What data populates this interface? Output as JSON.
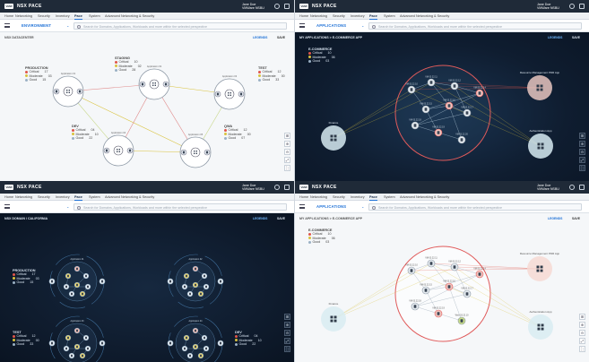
{
  "app": {
    "logo": "VMW",
    "name": "NSX PACE",
    "user_name": "Jane Doe",
    "user_org": "VMWare NSBU"
  },
  "nav": [
    "Home",
    "Networking",
    "Security",
    "Inventory",
    "Pace",
    "System",
    "Advanced Networking & Security"
  ],
  "search": {
    "placeholder": "Search for Domains, Applications, Workloads and more within the selected perspective"
  },
  "toolbar": {
    "legends": "LEGENDS",
    "save": "SAVE"
  },
  "zoom_controls": [
    "⊞",
    "⊕",
    "⊖",
    "⤢",
    "⛶"
  ],
  "legend_levels": {
    "critical": "Critical",
    "moderate": "Moderate",
    "good": "Good"
  },
  "colors": {
    "critical": "#e0554a",
    "moderate": "#d9c23c",
    "good": "#9ab0c4",
    "accent": "#1b6fd6"
  },
  "panels": [
    {
      "context": "ENVIRONMENT",
      "breadcrumb": "NSX DATACENTER",
      "groups": [
        {
          "name": "PRODUCTION",
          "critical": "17",
          "moderate": "03",
          "good": "15"
        },
        {
          "name": "STAGING",
          "critical": "10",
          "moderate": "02",
          "good": "28"
        },
        {
          "name": "TEST",
          "critical": "12",
          "moderate": "00",
          "good": "33"
        },
        {
          "name": "DEV",
          "critical": "04",
          "moderate": "10",
          "good": "22"
        },
        {
          "name": "QWA",
          "critical": "12",
          "moderate": "00",
          "good": "07"
        }
      ],
      "app_labels": [
        "Application 01",
        "Application 02",
        "Application 03",
        "Application 04",
        "Application 05"
      ]
    },
    {
      "context": "APPLICATIONS",
      "breadcrumb": "MY APPLICATIONS > E-COMMERCE APP",
      "legend_title": "E-COMMERCE",
      "legend": {
        "critical": "10",
        "moderate": "06",
        "good": "03"
      },
      "external": [
        "Finance",
        "Resource Management PDR App",
        "Authentication App"
      ],
      "vms": [
        "VM 03.22.10",
        "VM 03.22.11",
        "VM 03.22.12",
        "VM 03.22.14",
        "VM 03.22.15",
        "VM 03.22.16",
        "VM 03.22.17",
        "VM 03.22.18",
        "VM 03.22.19",
        "VM 03.22.20"
      ]
    },
    {
      "context": "",
      "breadcrumb": "NSX DOMAIN / CALIFORNIA",
      "groups": [
        {
          "name": "PRODUCTION",
          "critical": "17",
          "moderate": "03",
          "good": "15"
        },
        {
          "name": "TEST",
          "critical": "12",
          "moderate": "00",
          "good": "33"
        },
        {
          "name": "DEV",
          "critical": "04",
          "moderate": "10",
          "good": "22"
        }
      ],
      "cluster_labels": [
        "Application 01",
        "Application 02",
        "Application 03",
        "Application 04"
      ]
    },
    {
      "context": "APPLICATIONS",
      "breadcrumb": "MY APPLICATIONS > E-COMMERCE APP",
      "legend_title": "E-COMMERCE",
      "legend": {
        "critical": "10",
        "moderate": "06",
        "good": "03"
      },
      "external": [
        "Finance",
        "Resource Management PDR App",
        "Authentication App"
      ],
      "vms": [
        "VM 03.22.10",
        "VM 03.22.11",
        "VM 03.22.12",
        "VM 03.22.14",
        "VM 03.22.15",
        "VM 03.22.16",
        "VM 03.22.17",
        "VM 03.22.18",
        "VM 03.22.19",
        "Web 03.22.10"
      ]
    }
  ]
}
